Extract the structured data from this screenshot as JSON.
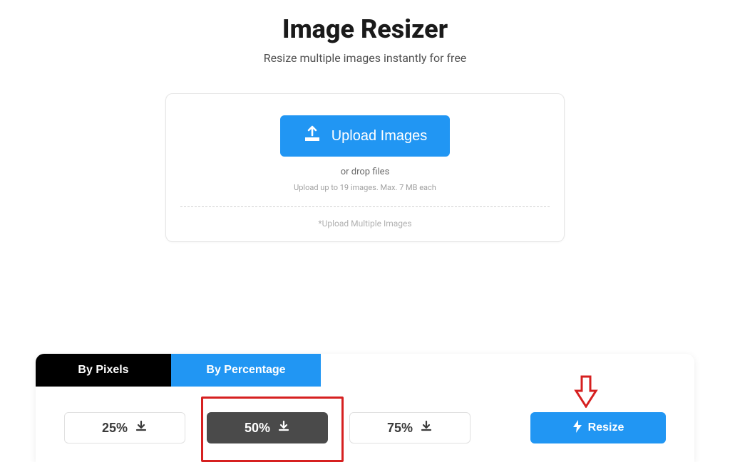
{
  "header": {
    "title": "Image Resizer",
    "subtitle": "Resize multiple images instantly for free"
  },
  "upload": {
    "button_label": "Upload Images",
    "drop_text": "or drop files",
    "limit_text": "Upload up to 19 images. Max. 7 MB each",
    "multiple_text": "*Upload Multiple Images"
  },
  "tabs": {
    "pixels_label": "By Pixels",
    "percentage_label": "By Percentage"
  },
  "percentage_options": {
    "opt25": "25%",
    "opt50": "50%",
    "opt75": "75%"
  },
  "resize": {
    "button_label": "Resize"
  }
}
